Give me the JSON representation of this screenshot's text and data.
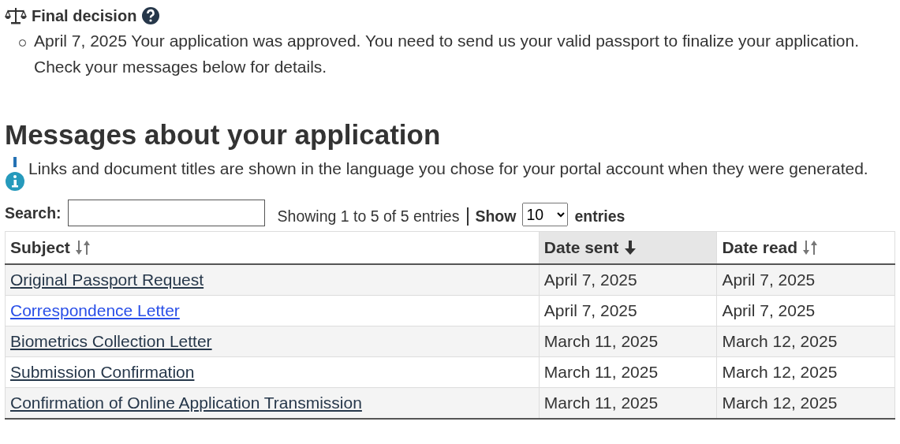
{
  "decision": {
    "title": "Final decision",
    "items": [
      "April 7, 2025 Your application was approved. You need to send us your valid passport to finalize your application. Check your messages below for details."
    ]
  },
  "messages": {
    "heading": "Messages about your application",
    "notice": "Links and document titles are shown in the language you chose for your portal account when they were generated.",
    "search": {
      "label": "Search:"
    },
    "info": "Showing 1 to 5 of 5 entries",
    "show_label": "Show",
    "page_size": "10",
    "entries_label": "entries",
    "columns": [
      {
        "label": "Subject",
        "sorted": false
      },
      {
        "label": "Date sent",
        "sorted": true
      },
      {
        "label": "Date read",
        "sorted": false
      }
    ],
    "rows": [
      {
        "subject": "Original Passport Request",
        "visited": true,
        "sent": "April 7, 2025",
        "read": "April 7, 2025"
      },
      {
        "subject": "Correspondence Letter",
        "visited": false,
        "sent": "April 7, 2025",
        "read": "April 7, 2025"
      },
      {
        "subject": "Biometrics Collection Letter",
        "visited": true,
        "sent": "March 11, 2025",
        "read": "March 12, 2025"
      },
      {
        "subject": "Submission Confirmation",
        "visited": true,
        "sent": "March 11, 2025",
        "read": "March 12, 2025"
      },
      {
        "subject": "Confirmation of Online Application Transmission",
        "visited": true,
        "sent": "March 11, 2025",
        "read": "March 12, 2025"
      }
    ]
  }
}
